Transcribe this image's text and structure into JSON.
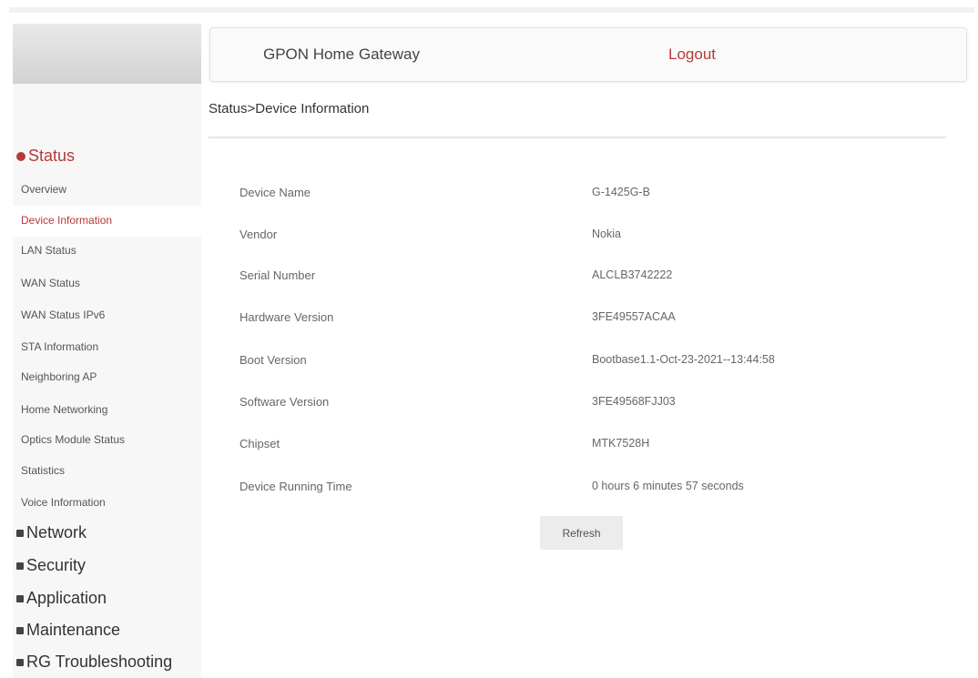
{
  "header": {
    "title": "GPON Home Gateway",
    "logout_label": "Logout"
  },
  "breadcrumb": "Status>Device Information",
  "sidebar": {
    "groups": [
      {
        "label": "Status",
        "active": true
      },
      {
        "label": "Network"
      },
      {
        "label": "Security"
      },
      {
        "label": "Application"
      },
      {
        "label": "Maintenance"
      },
      {
        "label": "RG Troubleshooting"
      }
    ],
    "status_items": [
      {
        "label": "Overview"
      },
      {
        "label": "Device Information",
        "active": true
      },
      {
        "label": "LAN Status"
      },
      {
        "label": "WAN Status"
      },
      {
        "label": "WAN Status IPv6"
      },
      {
        "label": "STA Information"
      },
      {
        "label": "Neighboring AP"
      },
      {
        "label": "Home Networking"
      },
      {
        "label": "Optics Module Status"
      },
      {
        "label": "Statistics"
      },
      {
        "label": "Voice Information"
      }
    ]
  },
  "device_info": [
    {
      "label": "Device Name",
      "value": "G-1425G-B"
    },
    {
      "label": "Vendor",
      "value": "Nokia"
    },
    {
      "label": "Serial Number",
      "value": "ALCLB3742222"
    },
    {
      "label": "Hardware Version",
      "value": "3FE49557ACAA"
    },
    {
      "label": "Boot Version",
      "value": "Bootbase1.1-Oct-23-2021--13:44:58"
    },
    {
      "label": "Software Version",
      "value": "3FE49568FJJ03"
    },
    {
      "label": "Chipset",
      "value": "MTK7528H"
    },
    {
      "label": "Device Running Time",
      "value": "0 hours 6 minutes 57 seconds"
    }
  ],
  "refresh_label": "Refresh",
  "colors": {
    "accent": "#b8393a",
    "sidebar_bg": "#f7f7f7",
    "button_bg": "#ececec"
  }
}
